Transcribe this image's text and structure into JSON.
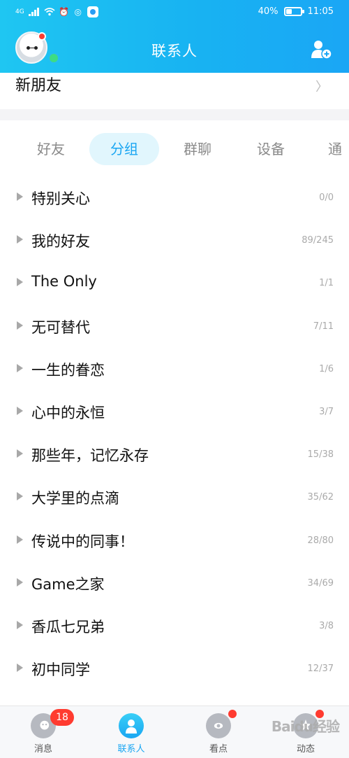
{
  "status_bar": {
    "network": "4G",
    "battery": "40%",
    "battery_level": 0.4,
    "time": "11:05"
  },
  "header": {
    "title": "联系人"
  },
  "new_friends": {
    "label": "新朋友"
  },
  "tabs": [
    {
      "label": "好友",
      "active": false
    },
    {
      "label": "分组",
      "active": true
    },
    {
      "label": "群聊",
      "active": false
    },
    {
      "label": "设备",
      "active": false
    },
    {
      "label": "通讯",
      "active": false
    }
  ],
  "groups": [
    {
      "name": "特别关心",
      "count": "0/0"
    },
    {
      "name": "我的好友",
      "count": "89/245"
    },
    {
      "name": "The Only",
      "count": "1/1"
    },
    {
      "name": "无可替代",
      "count": "7/11"
    },
    {
      "name": "一生的眷恋",
      "count": "1/6"
    },
    {
      "name": "心中的永恒",
      "count": "3/7"
    },
    {
      "name": "那些年，记忆永存",
      "count": "15/38"
    },
    {
      "name": "大学里的点滴",
      "count": "35/62"
    },
    {
      "name": "传说中的同事！",
      "count": "28/80"
    },
    {
      "name": "Game之家",
      "count": "34/69"
    },
    {
      "name": "香瓜七兄弟",
      "count": "3/8"
    },
    {
      "name": "初中同学",
      "count": "12/37"
    }
  ],
  "bottom_nav": [
    {
      "label": "消息",
      "badge": "18",
      "icon": "message-icon"
    },
    {
      "label": "联系人",
      "icon": "contacts-icon",
      "active": true
    },
    {
      "label": "看点",
      "icon": "eye-icon",
      "dot": true
    },
    {
      "label": "动态",
      "icon": "star-icon",
      "dot": true
    }
  ],
  "watermark": "Baidu经验",
  "colors": {
    "accent": "#1aa6f2",
    "badge": "#ff3b30"
  }
}
